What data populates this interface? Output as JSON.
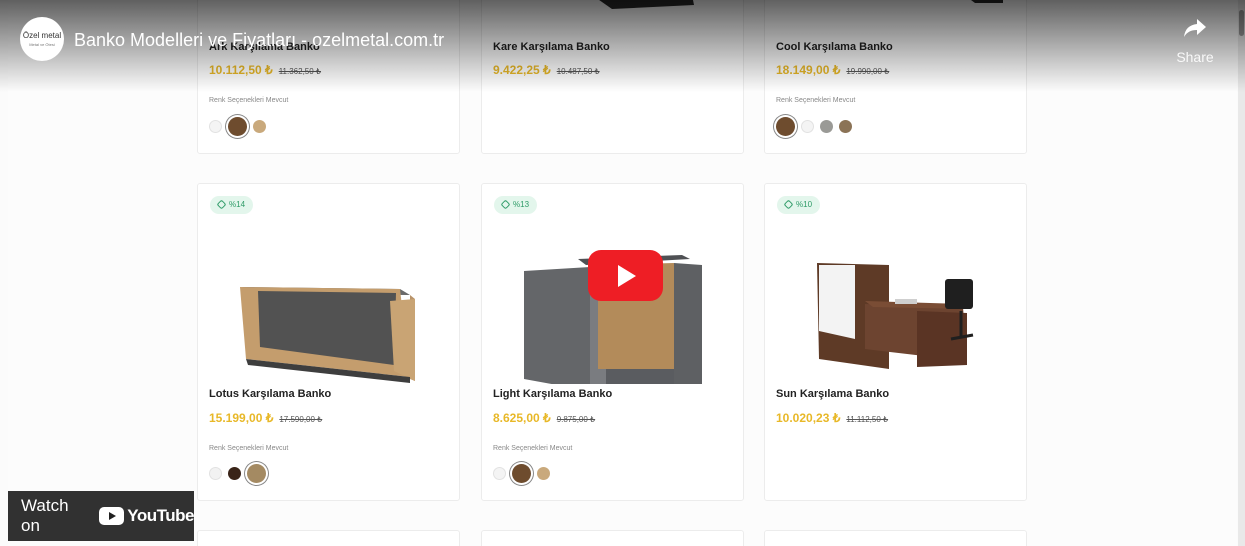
{
  "video": {
    "title": "Banko Modelleri ve Fiyatları - ozelmetal.com.tr",
    "channel_logo_text": "Özel metal",
    "channel_logo_sub": "Metal ve Ötesi",
    "share_label": "Share",
    "watch_on_label": "Watch on",
    "youtube_label": "YouTube"
  },
  "options_label": "Renk Seçenekleri Mevcut",
  "products_top": [
    {
      "name": "Ark Karşılama Banko",
      "price": "10.112,50 ₺",
      "old_price": "11.362,50 ₺",
      "swatches": [
        "#f4f4f4",
        "#6e4c2e",
        "#c9a97c"
      ],
      "selected": 1
    },
    {
      "name": "Kare Karşılama Banko",
      "price": "9.422,25 ₺",
      "old_price": "10.487,50 ₺",
      "swatches": [],
      "selected": -1
    },
    {
      "name": "Cool Karşılama Banko",
      "price": "18.149,00 ₺",
      "old_price": "19.990,00 ₺",
      "swatches": [
        "#6e4c2e",
        "#f4f4f4",
        "#9a9a96",
        "#8b7356"
      ],
      "selected": 0
    }
  ],
  "products_mid": [
    {
      "badge": "%14",
      "name": "Lotus Karşılama Banko",
      "price": "15.199,00 ₺",
      "old_price": "17.590,00 ₺",
      "swatches": [
        "#f2f2f2",
        "#3a2418",
        "#a48a62"
      ],
      "selected": 2
    },
    {
      "badge": "%13",
      "name": "Light Karşılama Banko",
      "price": "8.625,00 ₺",
      "old_price": "9.875,00 ₺",
      "swatches": [
        "#f4f4f4",
        "#6e4c2e",
        "#c9a97c"
      ],
      "selected": 1
    },
    {
      "badge": "%10",
      "name": "Sun Karşılama Banko",
      "price": "10.020,23 ₺",
      "old_price": "11.112,50 ₺",
      "swatches": [],
      "selected": -1
    }
  ],
  "colors": {
    "price": "#e8b828",
    "badge_bg": "#e3f6ec",
    "badge_text": "#2e9b67",
    "play_red": "#ee1e25"
  }
}
